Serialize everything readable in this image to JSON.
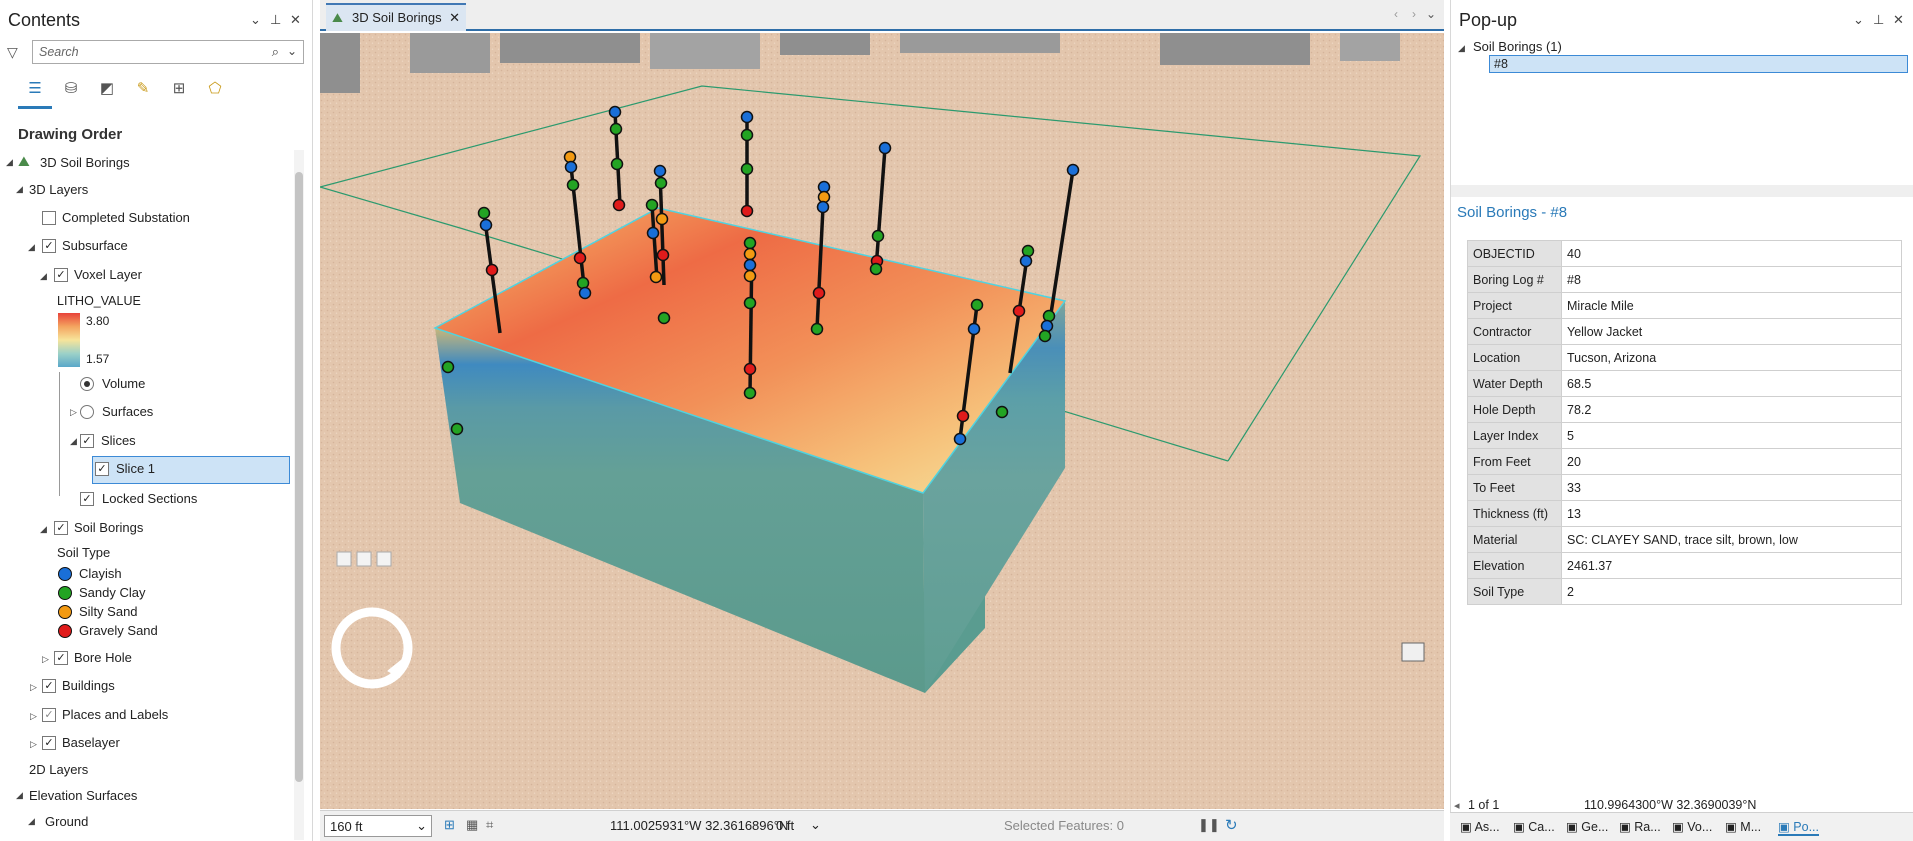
{
  "contents": {
    "title": "Contents",
    "search_placeholder": "Search",
    "drawing_order": "Drawing Order",
    "tree": {
      "map": "3D Soil Borings",
      "layers_3d": "3D Layers",
      "completed_substation": "Completed Substation",
      "subsurface": "Subsurface",
      "voxel_layer": "Voxel Layer",
      "litho_value": "LITHO_VALUE",
      "litho_max": "3.80",
      "litho_min": "1.57",
      "volume": "Volume",
      "surfaces": "Surfaces",
      "slices": "Slices",
      "slice1": "Slice 1",
      "locked_sections": "Locked Sections",
      "soil_borings": "Soil Borings",
      "soil_type": "Soil Type",
      "legend": [
        {
          "label": "Clayish",
          "color": "#1a6fd8"
        },
        {
          "label": "Sandy Clay",
          "color": "#23a423"
        },
        {
          "label": "Silty Sand",
          "color": "#f39a12"
        },
        {
          "label": "Gravely Sand",
          "color": "#e01b1b"
        }
      ],
      "bore_hole": "Bore Hole",
      "buildings": "Buildings",
      "places_labels": "Places and Labels",
      "baselayer": "Baselayer",
      "layers_2d": "2D Layers",
      "elevation_surfaces": "Elevation Surfaces",
      "ground": "Ground"
    }
  },
  "view": {
    "tab_title": "3D Soil Borings",
    "scale": "160 ft",
    "coordinates": "111.0025931°W 32.3616896°N",
    "elevation": "0 ft",
    "selected_features": "Selected Features: 0"
  },
  "popup": {
    "title": "Pop-up",
    "layer_node": "Soil Borings  (1)",
    "feature_node": "#8",
    "header": "Soil Borings - #8",
    "attributes": [
      {
        "k": "OBJECTID",
        "v": "40"
      },
      {
        "k": "Boring Log #",
        "v": "#8"
      },
      {
        "k": "Project",
        "v": "Miracle Mile"
      },
      {
        "k": "Contractor",
        "v": "Yellow Jacket"
      },
      {
        "k": "Location",
        "v": "Tucson, Arizona"
      },
      {
        "k": "Water Depth",
        "v": "68.5"
      },
      {
        "k": "Hole Depth",
        "v": "78.2"
      },
      {
        "k": "Layer Index",
        "v": "5"
      },
      {
        "k": "From Feet",
        "v": "20"
      },
      {
        "k": "To Feet",
        "v": "33"
      },
      {
        "k": "Thickness (ft)",
        "v": "13"
      },
      {
        "k": "Material",
        "v": "SC: CLAYEY SAND, trace silt, brown, low"
      },
      {
        "k": "Elevation",
        "v": "2461.37"
      },
      {
        "k": "Soil Type",
        "v": "2"
      }
    ],
    "paging": "1 of 1",
    "coordinates": "110.9964300°W 32.3690039°N"
  },
  "bottom_tabs": [
    "As...",
    "Ca...",
    "Ge...",
    "Ra...",
    "Vo...",
    "M...",
    "Po..."
  ],
  "colors": {
    "clayish": "#1a6fd8",
    "sandy_clay": "#23a423",
    "silty_sand": "#f39a12",
    "gravely_sand": "#e01b1b",
    "accent": "#2f6ea8"
  }
}
